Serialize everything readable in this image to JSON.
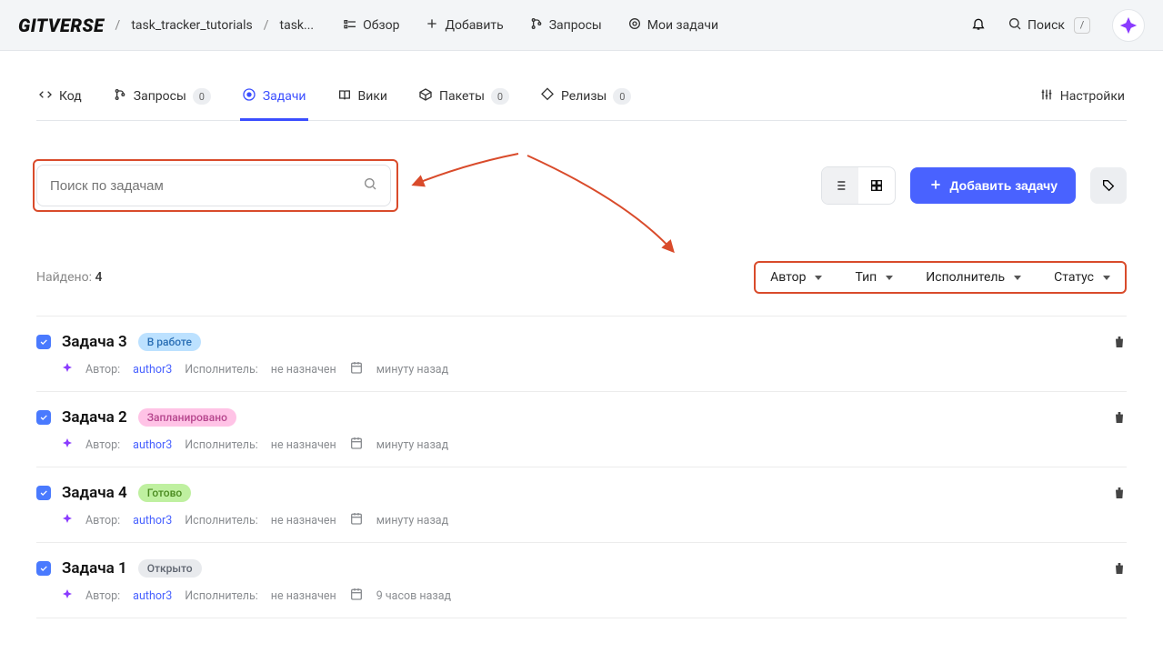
{
  "brand": "GITVERSE",
  "breadcrumbs": {
    "repo": "task_tracker_tutorials",
    "sub": "task..."
  },
  "topnav": {
    "overview": "Обзор",
    "add": "Добавить",
    "requests": "Запросы",
    "my_tasks": "Мои задачи",
    "search": "Поиск",
    "search_kbd": "/"
  },
  "tabs": {
    "code": "Код",
    "requests": "Запросы",
    "requests_count": "0",
    "tasks": "Задачи",
    "wiki": "Вики",
    "packages": "Пакеты",
    "packages_count": "0",
    "releases": "Релизы",
    "releases_count": "0",
    "settings": "Настройки"
  },
  "search": {
    "placeholder": "Поиск по задачам"
  },
  "actions": {
    "add_task": "Добавить задачу"
  },
  "found": {
    "label": "Найдено:",
    "count": "4"
  },
  "filters": {
    "author": "Автор",
    "type": "Тип",
    "assignee": "Исполнитель",
    "status": "Статус"
  },
  "task_meta_labels": {
    "author": "Автор:",
    "assignee": "Исполнитель:"
  },
  "status_colors": {
    "work_bg": "#bce1ff",
    "work_fg": "#2a6fb5",
    "planned_bg": "#ffc3e6",
    "planned_fg": "#b6458d",
    "done_bg": "#bff0a0",
    "done_fg": "#4a8a1f",
    "open_bg": "#e8eaed",
    "open_fg": "#5f6570"
  },
  "tasks": [
    {
      "title": "Задача 3",
      "status": "В работе",
      "status_key": "work",
      "author": "author3",
      "assignee": "не назначен",
      "time": "минуту назад"
    },
    {
      "title": "Задача 2",
      "status": "Запланировано",
      "status_key": "planned",
      "author": "author3",
      "assignee": "не назначен",
      "time": "минуту назад"
    },
    {
      "title": "Задача 4",
      "status": "Готово",
      "status_key": "done",
      "author": "author3",
      "assignee": "не назначен",
      "time": "минуту назад"
    },
    {
      "title": "Задача 1",
      "status": "Открыто",
      "status_key": "open",
      "author": "author3",
      "assignee": "не назначен",
      "time": "9 часов назад"
    }
  ]
}
